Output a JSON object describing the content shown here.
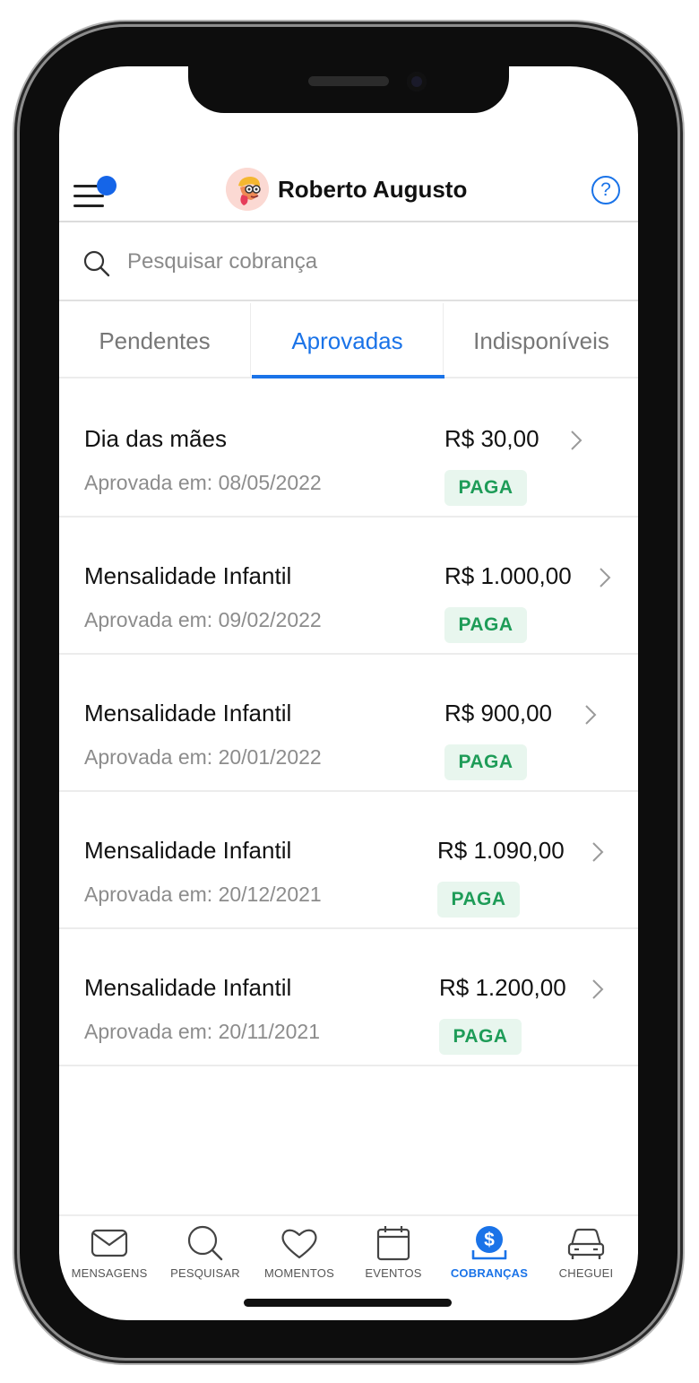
{
  "header": {
    "user_name": "Roberto Augusto",
    "help_label": "?"
  },
  "search": {
    "placeholder": "Pesquisar cobrança",
    "value": ""
  },
  "tabs": [
    {
      "label": "Pendentes",
      "active": false
    },
    {
      "label": "Aprovadas",
      "active": true
    },
    {
      "label": "Indisponíveis",
      "active": false
    }
  ],
  "charges": [
    {
      "title": "Dia das mães",
      "date": "Aprovada em: 08/05/2022",
      "amount": "R$ 30,00",
      "status": "PAGA"
    },
    {
      "title": "Mensalidade Infantil",
      "date": "Aprovada em: 09/02/2022",
      "amount": "R$ 1.000,00",
      "status": "PAGA"
    },
    {
      "title": "Mensalidade Infantil",
      "date": "Aprovada em: 20/01/2022",
      "amount": "R$ 900,00",
      "status": "PAGA"
    },
    {
      "title": "Mensalidade Infantil",
      "date": "Aprovada em: 20/12/2021",
      "amount": "R$ 1.090,00",
      "status": "PAGA"
    },
    {
      "title": "Mensalidade Infantil",
      "date": "Aprovada em: 20/11/2021",
      "amount": "R$ 1.200,00",
      "status": "PAGA"
    }
  ],
  "bottom_nav": [
    {
      "label": "MENSAGENS",
      "icon": "envelope-icon",
      "active": false
    },
    {
      "label": "PESQUISAR",
      "icon": "search-icon",
      "active": false
    },
    {
      "label": "MOMENTOS",
      "icon": "heart-icon",
      "active": false
    },
    {
      "label": "EVENTOS",
      "icon": "calendar-icon",
      "active": false
    },
    {
      "label": "COBRANÇAS",
      "icon": "dollar-icon",
      "active": true
    },
    {
      "label": "CHEGUEI",
      "icon": "car-icon",
      "active": false
    }
  ],
  "colors": {
    "accent": "#1a73e8",
    "paid_text": "#1e9c58",
    "paid_bg": "#e8f6ee",
    "notification_dot": "#1565e8"
  }
}
